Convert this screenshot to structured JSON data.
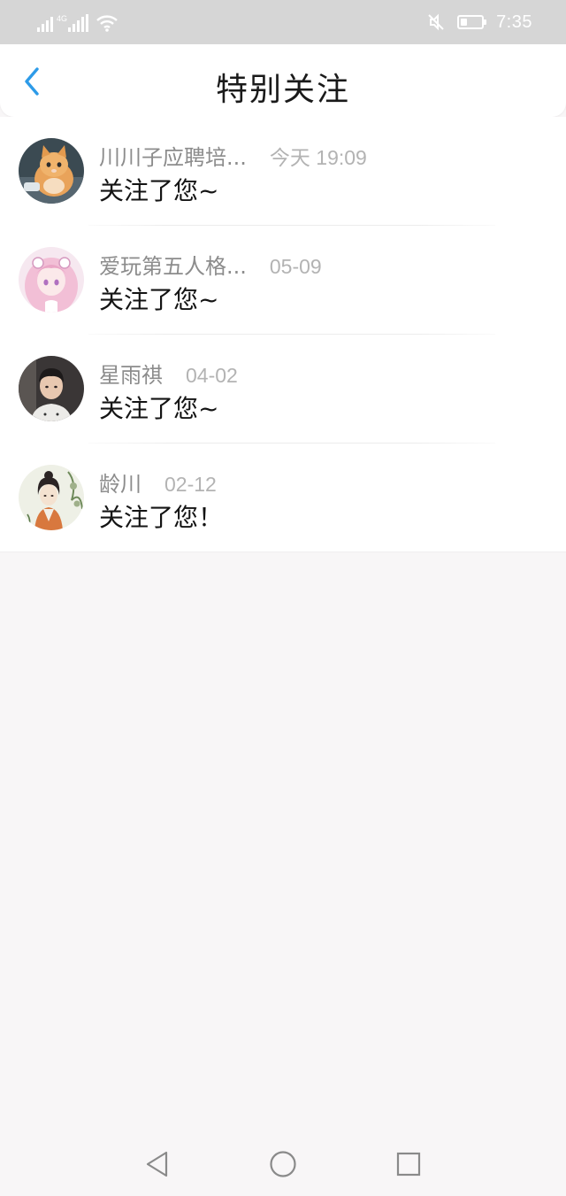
{
  "status_bar": {
    "network_label": "4G",
    "time": "7:35",
    "battery_level": 0.3,
    "icons": [
      "sim-signal-icon",
      "cellular-signal-icon",
      "wifi-icon",
      "mute-icon",
      "battery-icon"
    ]
  },
  "header": {
    "title": "特别关注",
    "back_icon": "chevron-left-icon",
    "accent_color": "#2d9be8"
  },
  "notifications": [
    {
      "name": "川川子应聘培...",
      "time": "今天 19:09",
      "message": "关注了您~",
      "avatar": "kitten-avatar"
    },
    {
      "name": "爱玩第五人格...",
      "time": "05-09",
      "message": "关注了您~",
      "avatar": "anime-pink-hair-avatar"
    },
    {
      "name": "星雨祺",
      "time": "04-02",
      "message": "关注了您~",
      "avatar": "young-man-avatar"
    },
    {
      "name": "龄川",
      "time": "02-12",
      "message": "关注了您！",
      "avatar": "illustrated-woman-avatar"
    }
  ],
  "nav_bar": {
    "icons": [
      "nav-back-icon",
      "nav-home-icon",
      "nav-recents-icon"
    ]
  }
}
